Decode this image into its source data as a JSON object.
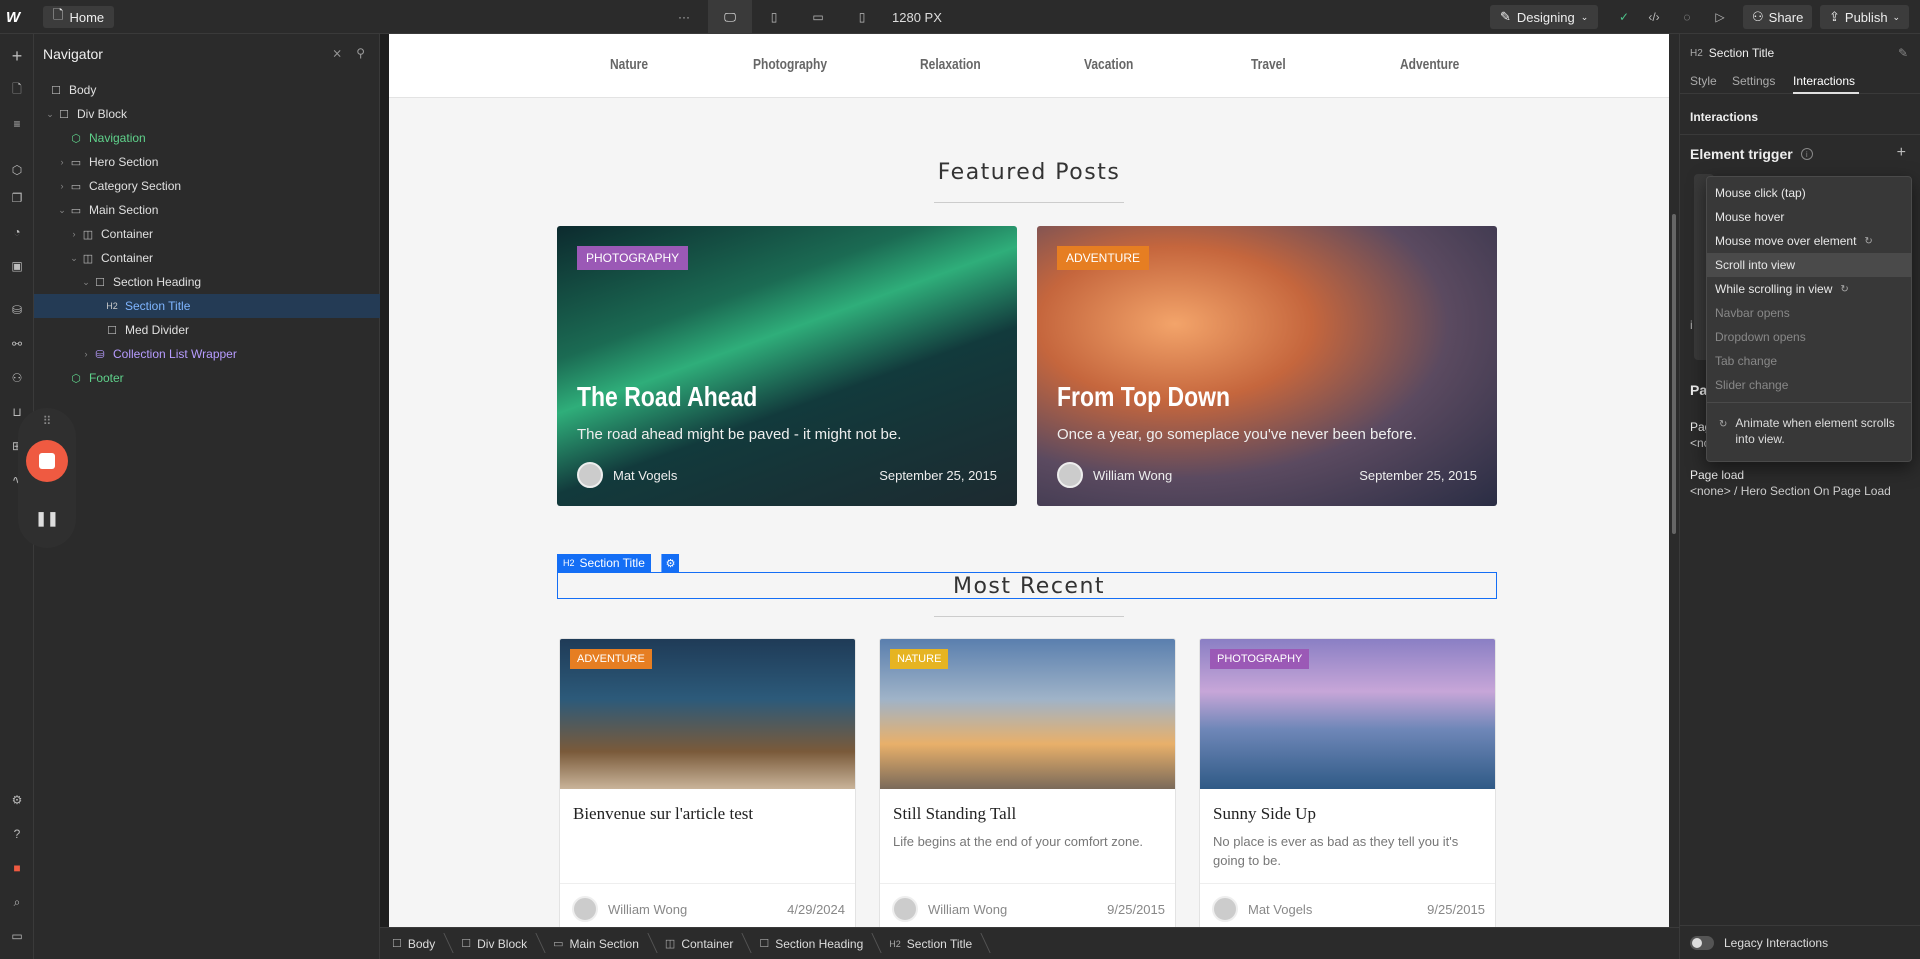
{
  "topbar": {
    "home_label": "Home",
    "more": "···",
    "width_label": "1280 PX",
    "mode_label": "Designing",
    "share_label": "Share",
    "publish_label": "Publish"
  },
  "navigator": {
    "title": "Navigator",
    "items": [
      {
        "label": "Body"
      },
      {
        "label": "Div Block"
      },
      {
        "label": "Navigation"
      },
      {
        "label": "Hero Section"
      },
      {
        "label": "Category Section"
      },
      {
        "label": "Main Section"
      },
      {
        "label": "Container"
      },
      {
        "label": "Container"
      },
      {
        "label": "Section Heading"
      },
      {
        "label": "Section Title",
        "prefix": "H2"
      },
      {
        "label": "Med Divider"
      },
      {
        "label": "Collection List Wrapper"
      },
      {
        "label": "Footer"
      }
    ]
  },
  "site": {
    "nav": [
      "Nature",
      "Photography",
      "Relaxation",
      "Vacation",
      "Travel",
      "Adventure"
    ],
    "featured_title": "Featured Posts",
    "featured": [
      {
        "tag": "PHOTOGRAPHY",
        "tag_color": "#9b59b6",
        "title": "The Road Ahead",
        "desc": "The road ahead might be paved - it might not be.",
        "author": "Mat Vogels",
        "date": "September 25, 2015"
      },
      {
        "tag": "ADVENTURE",
        "tag_color": "#e67e22",
        "title": "From Top Down",
        "desc": "Once a year, go someplace you've never been before.",
        "author": "William Wong",
        "date": "September 25, 2015"
      }
    ],
    "selection_label": "Section Title",
    "selection_prefix": "H2",
    "recent_title": "Most Recent",
    "recent": [
      {
        "tag": "ADVENTURE",
        "tag_color": "#e67e22",
        "title": "Bienvenue sur l'article test",
        "desc": "",
        "author": "William Wong",
        "date": "4/29/2024"
      },
      {
        "tag": "NATURE",
        "tag_color": "#e6b422",
        "title": "Still Standing Tall",
        "desc": "Life begins at the end of your comfort zone.",
        "author": "William Wong",
        "date": "9/25/2015"
      },
      {
        "tag": "PHOTOGRAPHY",
        "tag_color": "#9b59b6",
        "title": "Sunny Side Up",
        "desc": "No place is ever as bad as they tell you it's going to be.",
        "author": "Mat Vogels",
        "date": "9/25/2015"
      }
    ]
  },
  "breadcrumb": [
    {
      "label": "Body"
    },
    {
      "label": "Div Block"
    },
    {
      "label": "Main Section"
    },
    {
      "label": "Container"
    },
    {
      "label": "Section Heading"
    },
    {
      "label": "Section Title",
      "prefix": "H2"
    }
  ],
  "right_panel": {
    "element_prefix": "H2",
    "element_title": "Section Title",
    "tabs": [
      "Style",
      "Settings",
      "Interactions"
    ],
    "active_tab": "Interactions",
    "section": "Interactions",
    "element_trigger": "Element trigger",
    "page_trigger_partial": "Pag",
    "page_trigger_sub1": "Pag",
    "page_trigger_sub2": "<nc",
    "cut_letter": "i",
    "page_load": "Page load",
    "page_load_value": "<none> / Hero Section On Page Load",
    "legacy": "Legacy Interactions"
  },
  "dropdown": {
    "items": [
      {
        "label": "Mouse click (tap)"
      },
      {
        "label": "Mouse hover"
      },
      {
        "label": "Mouse move over element",
        "badge": "↻"
      },
      {
        "label": "Scroll into view"
      },
      {
        "label": "While scrolling in view",
        "badge": "↻"
      },
      {
        "label": "Navbar opens"
      },
      {
        "label": "Dropdown opens"
      },
      {
        "label": "Tab change"
      },
      {
        "label": "Slider change"
      }
    ],
    "highlighted": "Scroll into view",
    "description": "Animate when element scrolls into view."
  }
}
